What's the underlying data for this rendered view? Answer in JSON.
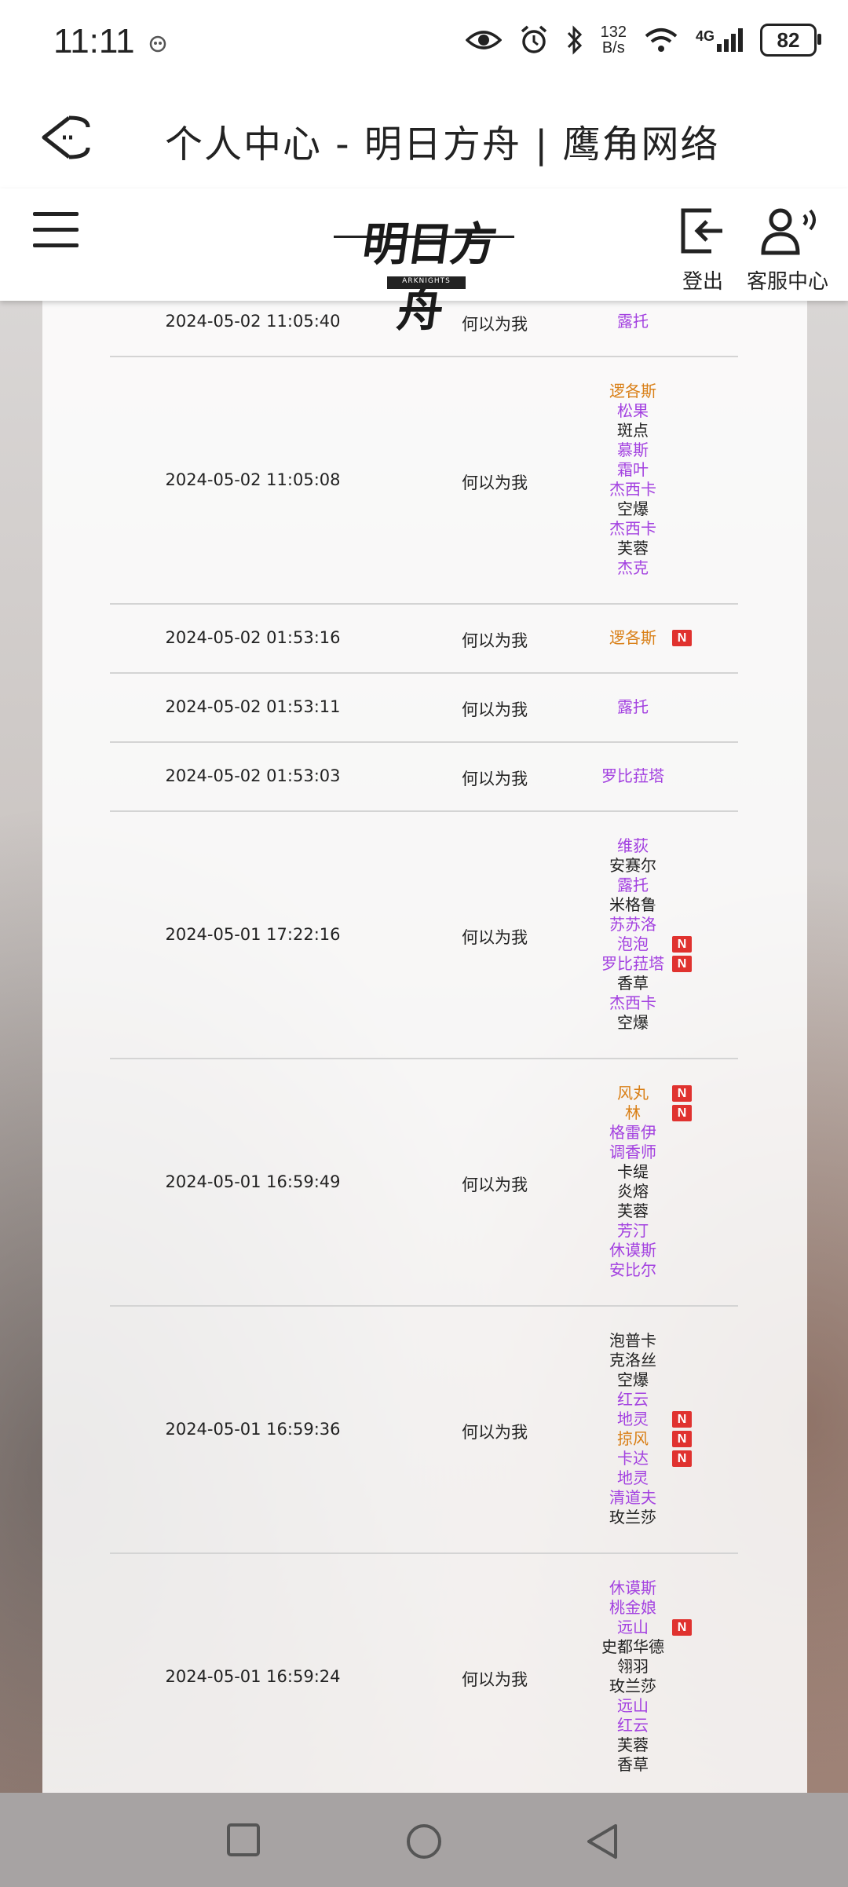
{
  "status_bar": {
    "time": "11:11",
    "net_speed_top": "132",
    "net_speed_bottom": "B/s",
    "network": "4G",
    "battery": "82"
  },
  "webview": {
    "title": "个人中心 - 明日方舟 | 鹰角网络"
  },
  "site_header": {
    "logout_label": "登出",
    "support_label": "客服中心",
    "logo_text": "明日方舟",
    "logo_sub": "ARKNIGHTS"
  },
  "colors": {
    "six_star": "#d97f16",
    "five_star": "#a341e0",
    "four_star": "#222222",
    "new_badge": "#e0322f"
  },
  "records": [
    {
      "date": "2024-05-02 11:05:40",
      "pool": "何以为我",
      "ops": [
        {
          "name": "露托",
          "rarity": "purple",
          "new": false
        }
      ]
    },
    {
      "date": "2024-05-02 11:05:08",
      "pool": "何以为我",
      "ops": [
        {
          "name": "逻各斯",
          "rarity": "gold",
          "new": false
        },
        {
          "name": "松果",
          "rarity": "purple",
          "new": false
        },
        {
          "name": "斑点",
          "rarity": "black",
          "new": false
        },
        {
          "name": "慕斯",
          "rarity": "purple",
          "new": false
        },
        {
          "name": "霜叶",
          "rarity": "purple",
          "new": false
        },
        {
          "name": "杰西卡",
          "rarity": "purple",
          "new": false
        },
        {
          "name": "空爆",
          "rarity": "black",
          "new": false
        },
        {
          "name": "杰西卡",
          "rarity": "purple",
          "new": false
        },
        {
          "name": "芙蓉",
          "rarity": "black",
          "new": false
        },
        {
          "name": "杰克",
          "rarity": "purple",
          "new": false
        }
      ]
    },
    {
      "date": "2024-05-02 01:53:16",
      "pool": "何以为我",
      "ops": [
        {
          "name": "逻各斯",
          "rarity": "gold",
          "new": true
        }
      ]
    },
    {
      "date": "2024-05-02 01:53:11",
      "pool": "何以为我",
      "ops": [
        {
          "name": "露托",
          "rarity": "purple",
          "new": false
        }
      ]
    },
    {
      "date": "2024-05-02 01:53:03",
      "pool": "何以为我",
      "ops": [
        {
          "name": "罗比菈塔",
          "rarity": "purple",
          "new": false
        }
      ]
    },
    {
      "date": "2024-05-01 17:22:16",
      "pool": "何以为我",
      "ops": [
        {
          "name": "维荻",
          "rarity": "purple",
          "new": false
        },
        {
          "name": "安赛尔",
          "rarity": "black",
          "new": false
        },
        {
          "name": "露托",
          "rarity": "purple",
          "new": false
        },
        {
          "name": "米格鲁",
          "rarity": "black",
          "new": false
        },
        {
          "name": "苏苏洛",
          "rarity": "purple",
          "new": false
        },
        {
          "name": "泡泡",
          "rarity": "purple",
          "new": true
        },
        {
          "name": "罗比菈塔",
          "rarity": "purple",
          "new": true
        },
        {
          "name": "香草",
          "rarity": "black",
          "new": false
        },
        {
          "name": "杰西卡",
          "rarity": "purple",
          "new": false
        },
        {
          "name": "空爆",
          "rarity": "black",
          "new": false
        }
      ]
    },
    {
      "date": "2024-05-01 16:59:49",
      "pool": "何以为我",
      "ops": [
        {
          "name": "风丸",
          "rarity": "gold",
          "new": true
        },
        {
          "name": "林",
          "rarity": "gold",
          "new": true
        },
        {
          "name": "格雷伊",
          "rarity": "purple",
          "new": false
        },
        {
          "name": "调香师",
          "rarity": "purple",
          "new": false
        },
        {
          "name": "卡缇",
          "rarity": "black",
          "new": false
        },
        {
          "name": "炎熔",
          "rarity": "black",
          "new": false
        },
        {
          "name": "芙蓉",
          "rarity": "black",
          "new": false
        },
        {
          "name": "芳汀",
          "rarity": "purple",
          "new": false
        },
        {
          "name": "休谟斯",
          "rarity": "purple",
          "new": false
        },
        {
          "name": "安比尔",
          "rarity": "purple",
          "new": false
        }
      ]
    },
    {
      "date": "2024-05-01 16:59:36",
      "pool": "何以为我",
      "ops": [
        {
          "name": "泡普卡",
          "rarity": "black",
          "new": false
        },
        {
          "name": "克洛丝",
          "rarity": "black",
          "new": false
        },
        {
          "name": "空爆",
          "rarity": "black",
          "new": false
        },
        {
          "name": "红云",
          "rarity": "purple",
          "new": false
        },
        {
          "name": "地灵",
          "rarity": "purple",
          "new": true
        },
        {
          "name": "掠风",
          "rarity": "gold",
          "new": true
        },
        {
          "name": "卡达",
          "rarity": "purple",
          "new": true
        },
        {
          "name": "地灵",
          "rarity": "purple",
          "new": false
        },
        {
          "name": "清道夫",
          "rarity": "purple",
          "new": false
        },
        {
          "name": "玫兰莎",
          "rarity": "black",
          "new": false
        }
      ]
    },
    {
      "date": "2024-05-01 16:59:24",
      "pool": "何以为我",
      "ops": [
        {
          "name": "休谟斯",
          "rarity": "purple",
          "new": false
        },
        {
          "name": "桃金娘",
          "rarity": "purple",
          "new": false
        },
        {
          "name": "远山",
          "rarity": "purple",
          "new": true
        },
        {
          "name": "史都华德",
          "rarity": "black",
          "new": false
        },
        {
          "name": "翎羽",
          "rarity": "black",
          "new": false
        },
        {
          "name": "玫兰莎",
          "rarity": "black",
          "new": false
        },
        {
          "name": "远山",
          "rarity": "purple",
          "new": false
        },
        {
          "name": "红云",
          "rarity": "purple",
          "new": false
        },
        {
          "name": "芙蓉",
          "rarity": "black",
          "new": false
        },
        {
          "name": "香草",
          "rarity": "black",
          "new": false
        }
      ]
    }
  ]
}
